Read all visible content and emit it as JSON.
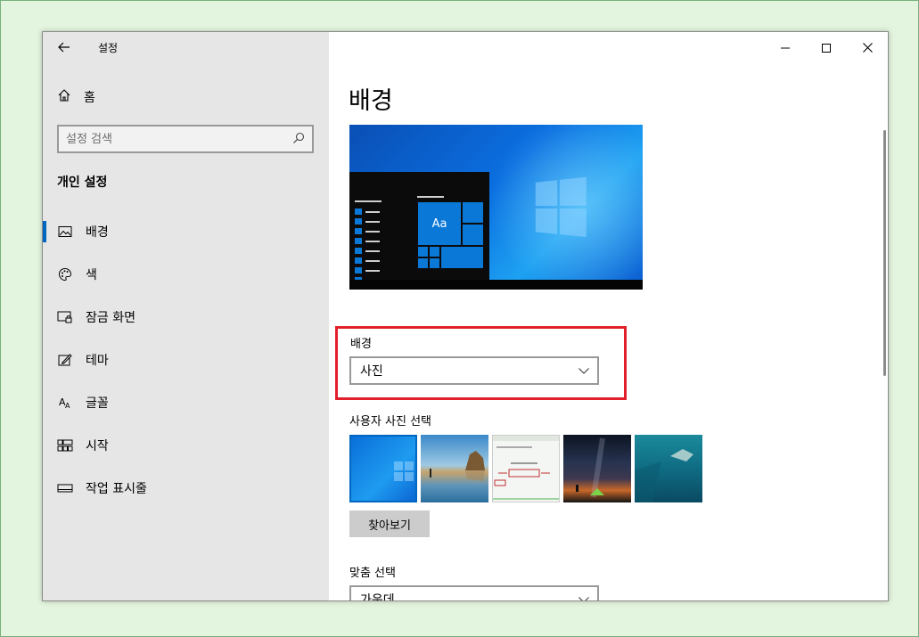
{
  "app": {
    "title": "설정"
  },
  "sidebar": {
    "home_label": "홈",
    "search_placeholder": "설정 검색",
    "section_title": "개인 설정",
    "items": [
      {
        "label": "배경",
        "icon": "picture-icon",
        "active": true
      },
      {
        "label": "색",
        "icon": "palette-icon",
        "active": false
      },
      {
        "label": "잠금 화면",
        "icon": "lock-screen-icon",
        "active": false
      },
      {
        "label": "테마",
        "icon": "theme-brush-icon",
        "active": false
      },
      {
        "label": "글꼴",
        "icon": "font-icon",
        "active": false
      },
      {
        "label": "시작",
        "icon": "start-grid-icon",
        "active": false
      },
      {
        "label": "작업 표시줄",
        "icon": "taskbar-icon",
        "active": false
      }
    ]
  },
  "main": {
    "page_title": "배경",
    "preview": {
      "tile_text": "Aa"
    },
    "background": {
      "label": "배경",
      "selected": "사진"
    },
    "photo_picker": {
      "label": "사용자 사진 선택",
      "browse_label": "찾아보기",
      "thumbnails": [
        "windows-default-wallpaper",
        "beach-rock-reflection",
        "web-page-screenshot",
        "night-sky-tent",
        "underwater-swimmer"
      ]
    },
    "fit": {
      "label": "맞춤 선택",
      "selected": "가운데"
    }
  },
  "colors": {
    "accent": "#0067c0",
    "highlight": "#e2202c",
    "sidebar_bg": "#e6e6e6"
  }
}
